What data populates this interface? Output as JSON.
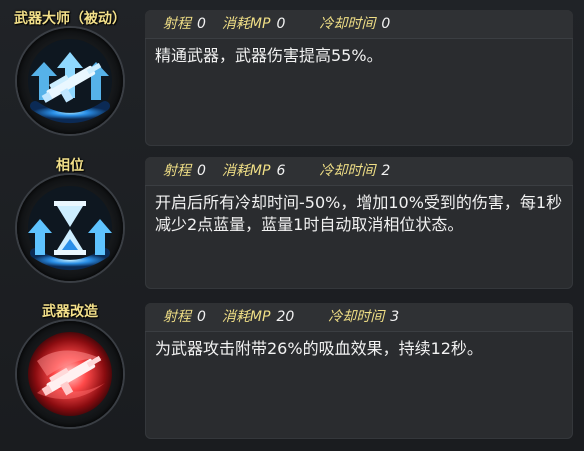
{
  "labels": {
    "range": "射程",
    "mp": "消耗MP",
    "cooldown": "冷却时间"
  },
  "skills": [
    {
      "name": "武器大师（被动）",
      "range": "0",
      "mp": "0",
      "cooldown": "0",
      "description": "精通武器，武器伤害提高55%。",
      "icon": "weapon-upgrade-icon",
      "accent": "#3aa6ff"
    },
    {
      "name": "相位",
      "range": "0",
      "mp": "6",
      "cooldown": "2",
      "description": "开启后所有冷却时间-50%，增加10%受到的伤害，每1秒减少2点蓝量，蓝量1时自动取消相位状态。",
      "icon": "hourglass-phase-icon",
      "accent": "#3aa6ff"
    },
    {
      "name": "武器改造",
      "range": "0",
      "mp": "20",
      "cooldown": "3",
      "description": "为武器攻击附带26%的吸血效果，持续12秒。",
      "icon": "blood-weapon-icon",
      "accent": "#e02a2a"
    }
  ]
}
